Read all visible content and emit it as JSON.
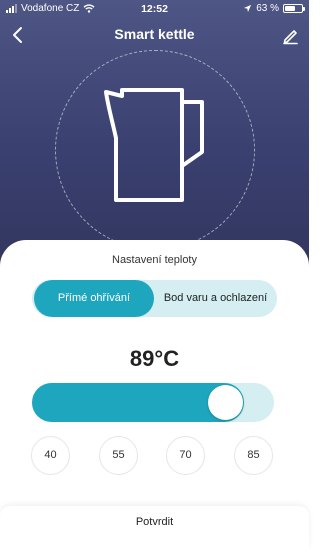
{
  "status_bar": {
    "carrier": "Vodafone CZ",
    "time": "12:52",
    "battery": "63 %",
    "battery_level": 0.63
  },
  "header": {
    "title": "Smart kettle",
    "back_icon": "chevron-left-icon",
    "edit_icon": "pencil-icon"
  },
  "settings": {
    "title": "Nastavení teploty",
    "modes": [
      {
        "label": "Přímé ohřívání",
        "active": true
      },
      {
        "label": "Bod varu a ochlazení",
        "active": false
      }
    ],
    "temperature_label": "89°C",
    "slider": {
      "min": 0,
      "max": 100,
      "value": 89
    },
    "presets": [
      "40",
      "55",
      "70",
      "85"
    ]
  },
  "footer": {
    "confirm_label": "Potvrdit"
  },
  "colors": {
    "accent": "#1fa6bf",
    "accent_light": "#d4eef2",
    "header_top": "#4e5685",
    "header_bottom": "#32365f"
  }
}
